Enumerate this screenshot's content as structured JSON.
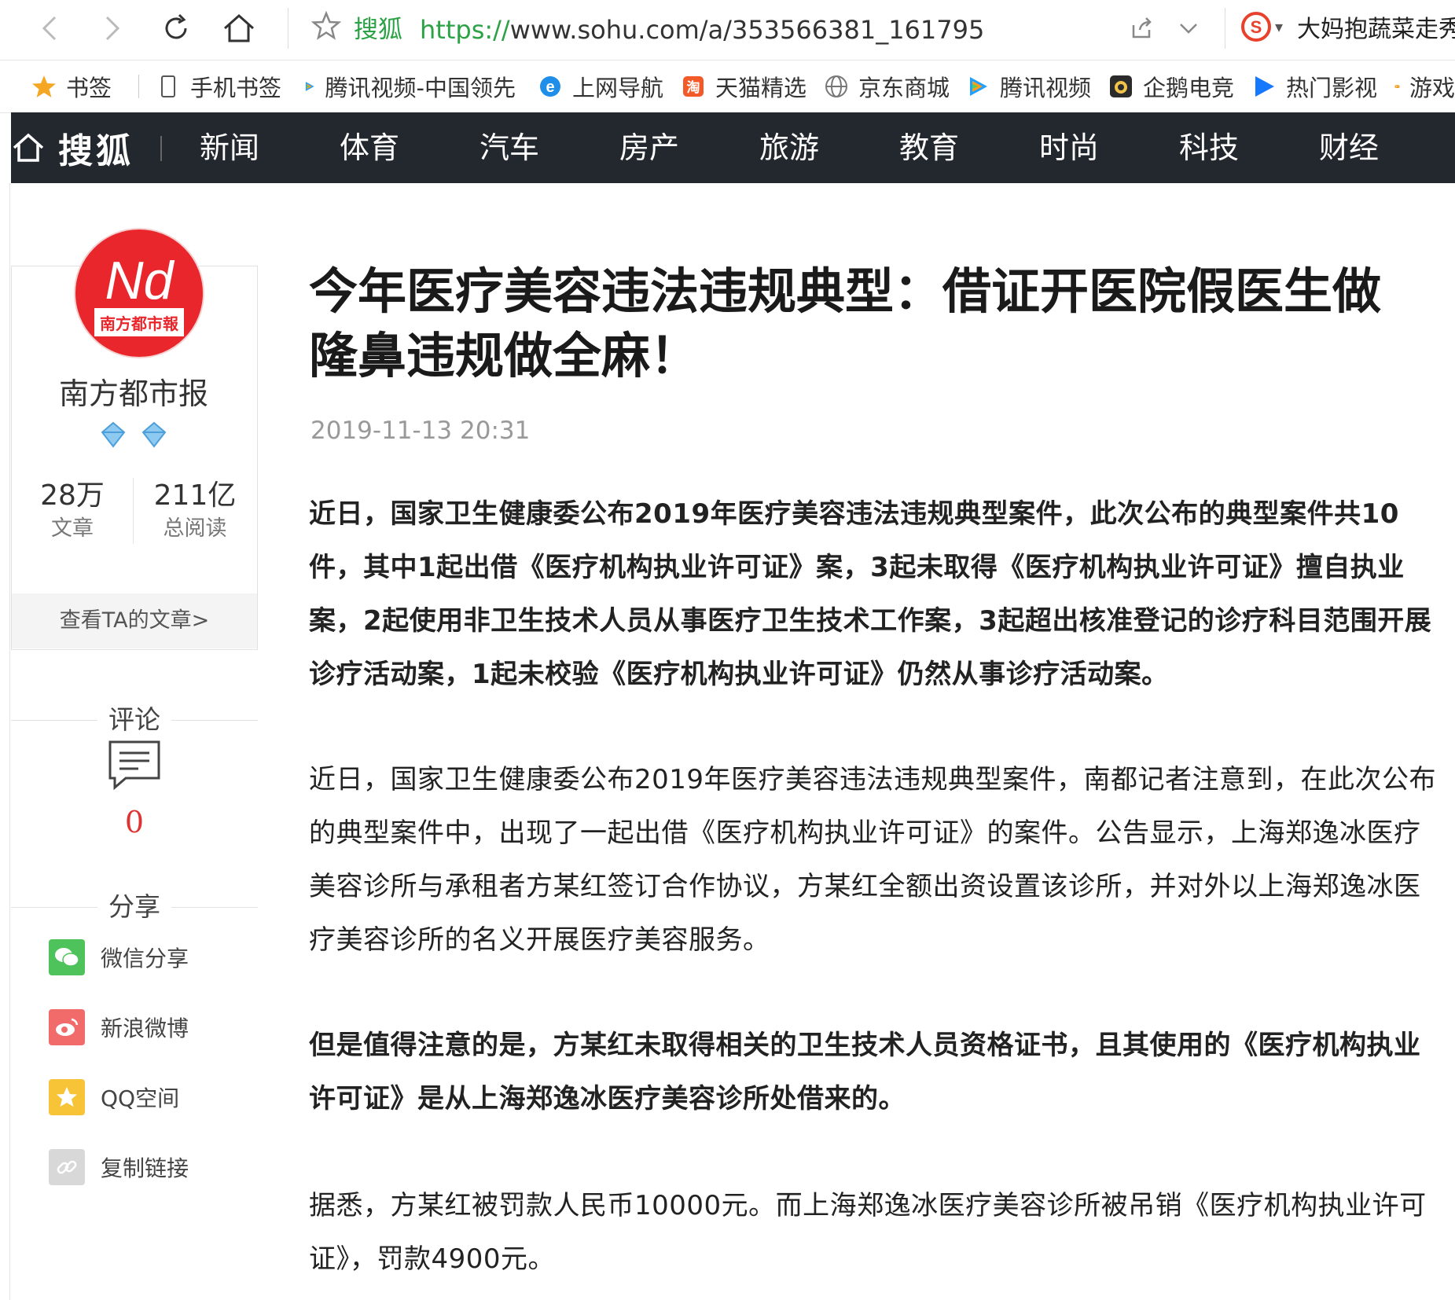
{
  "browser": {
    "site_name": "搜狐",
    "url_protocol": "https://",
    "url_rest": "www.sohu.com/a/353566381_161795",
    "search_text": "大妈抱蔬菜走秀",
    "bookmarks": [
      {
        "label": "书签",
        "icon": "star-icon"
      },
      {
        "label": "手机书签",
        "icon": "phone-icon"
      },
      {
        "label": "腾讯视频-中国领先",
        "icon": "tencent-video-icon"
      },
      {
        "label": "上网导航",
        "icon": "ie-icon"
      },
      {
        "label": "天猫精选",
        "icon": "tmall-icon"
      },
      {
        "label": "京东商城",
        "icon": "globe-icon"
      },
      {
        "label": "腾讯视频",
        "icon": "tencent-video-icon"
      },
      {
        "label": "企鹅电竞",
        "icon": "penguin-icon"
      },
      {
        "label": "热门影视",
        "icon": "play-icon"
      },
      {
        "label": "游戏",
        "icon": "gamepad-icon"
      }
    ]
  },
  "sohu": {
    "logo": "搜狐",
    "nav": [
      "新闻",
      "体育",
      "汽车",
      "房产",
      "旅游",
      "教育",
      "时尚",
      "科技",
      "财经"
    ]
  },
  "author": {
    "logo_text": "南方都市報",
    "logo_mark": "Nd",
    "name": "南方都市报",
    "articles_count": "28万",
    "articles_label": "文章",
    "reads_count": "211亿",
    "reads_label": "总阅读",
    "view_link": "查看TA的文章>"
  },
  "comments": {
    "heading": "评论",
    "count": "0"
  },
  "share": {
    "heading": "分享",
    "items": [
      {
        "label": "微信分享",
        "icon": "wechat-icon",
        "color": "#4fc35b"
      },
      {
        "label": "新浪微博",
        "icon": "weibo-icon",
        "color": "#f26b6b"
      },
      {
        "label": "QQ空间",
        "icon": "qzone-icon",
        "color": "#f7c437"
      },
      {
        "label": "复制链接",
        "icon": "link-icon",
        "color": "#d8d8d8"
      }
    ]
  },
  "article": {
    "title": "今年医疗美容违法违规典型：借证开医院假医生做隆鼻违规做全麻！",
    "time": "2019-11-13 20:31",
    "paragraphs": [
      "近日，国家卫生健康委公布2019年医疗美容违法违规典型案件，此次公布的典型案件共10件，其中1起出借《医疗机构执业许可证》案，3起未取得《医疗机构执业许可证》擅自执业案，2起使用非卫生技术人员从事医疗卫生技术工作案，3起超出核准登记的诊疗科目范围开展诊疗活动案，1起未校验《医疗机构执业许可证》仍然从事诊疗活动案。",
      "近日，国家卫生健康委公布2019年医疗美容违法违规典型案件，南都记者注意到，在此次公布的典型案件中，出现了一起出借《医疗机构执业许可证》的案件。公告显示，上海郑逸冰医疗美容诊所与承租者方某红签订合作协议，方某红全额出资设置该诊所，并对外以上海郑逸冰医疗美容诊所的名义开展医疗美容服务。",
      "但是值得注意的是，方某红未取得相关的卫生技术人员资格证书，且其使用的《医疗机构执业许可证》是从上海郑逸冰医疗美容诊所处借来的。",
      "据悉，方某红被罚款人民币10000元。而上海郑逸冰医疗美容诊所被吊销《医疗机构执业许可证》，罚款4900元。"
    ]
  }
}
